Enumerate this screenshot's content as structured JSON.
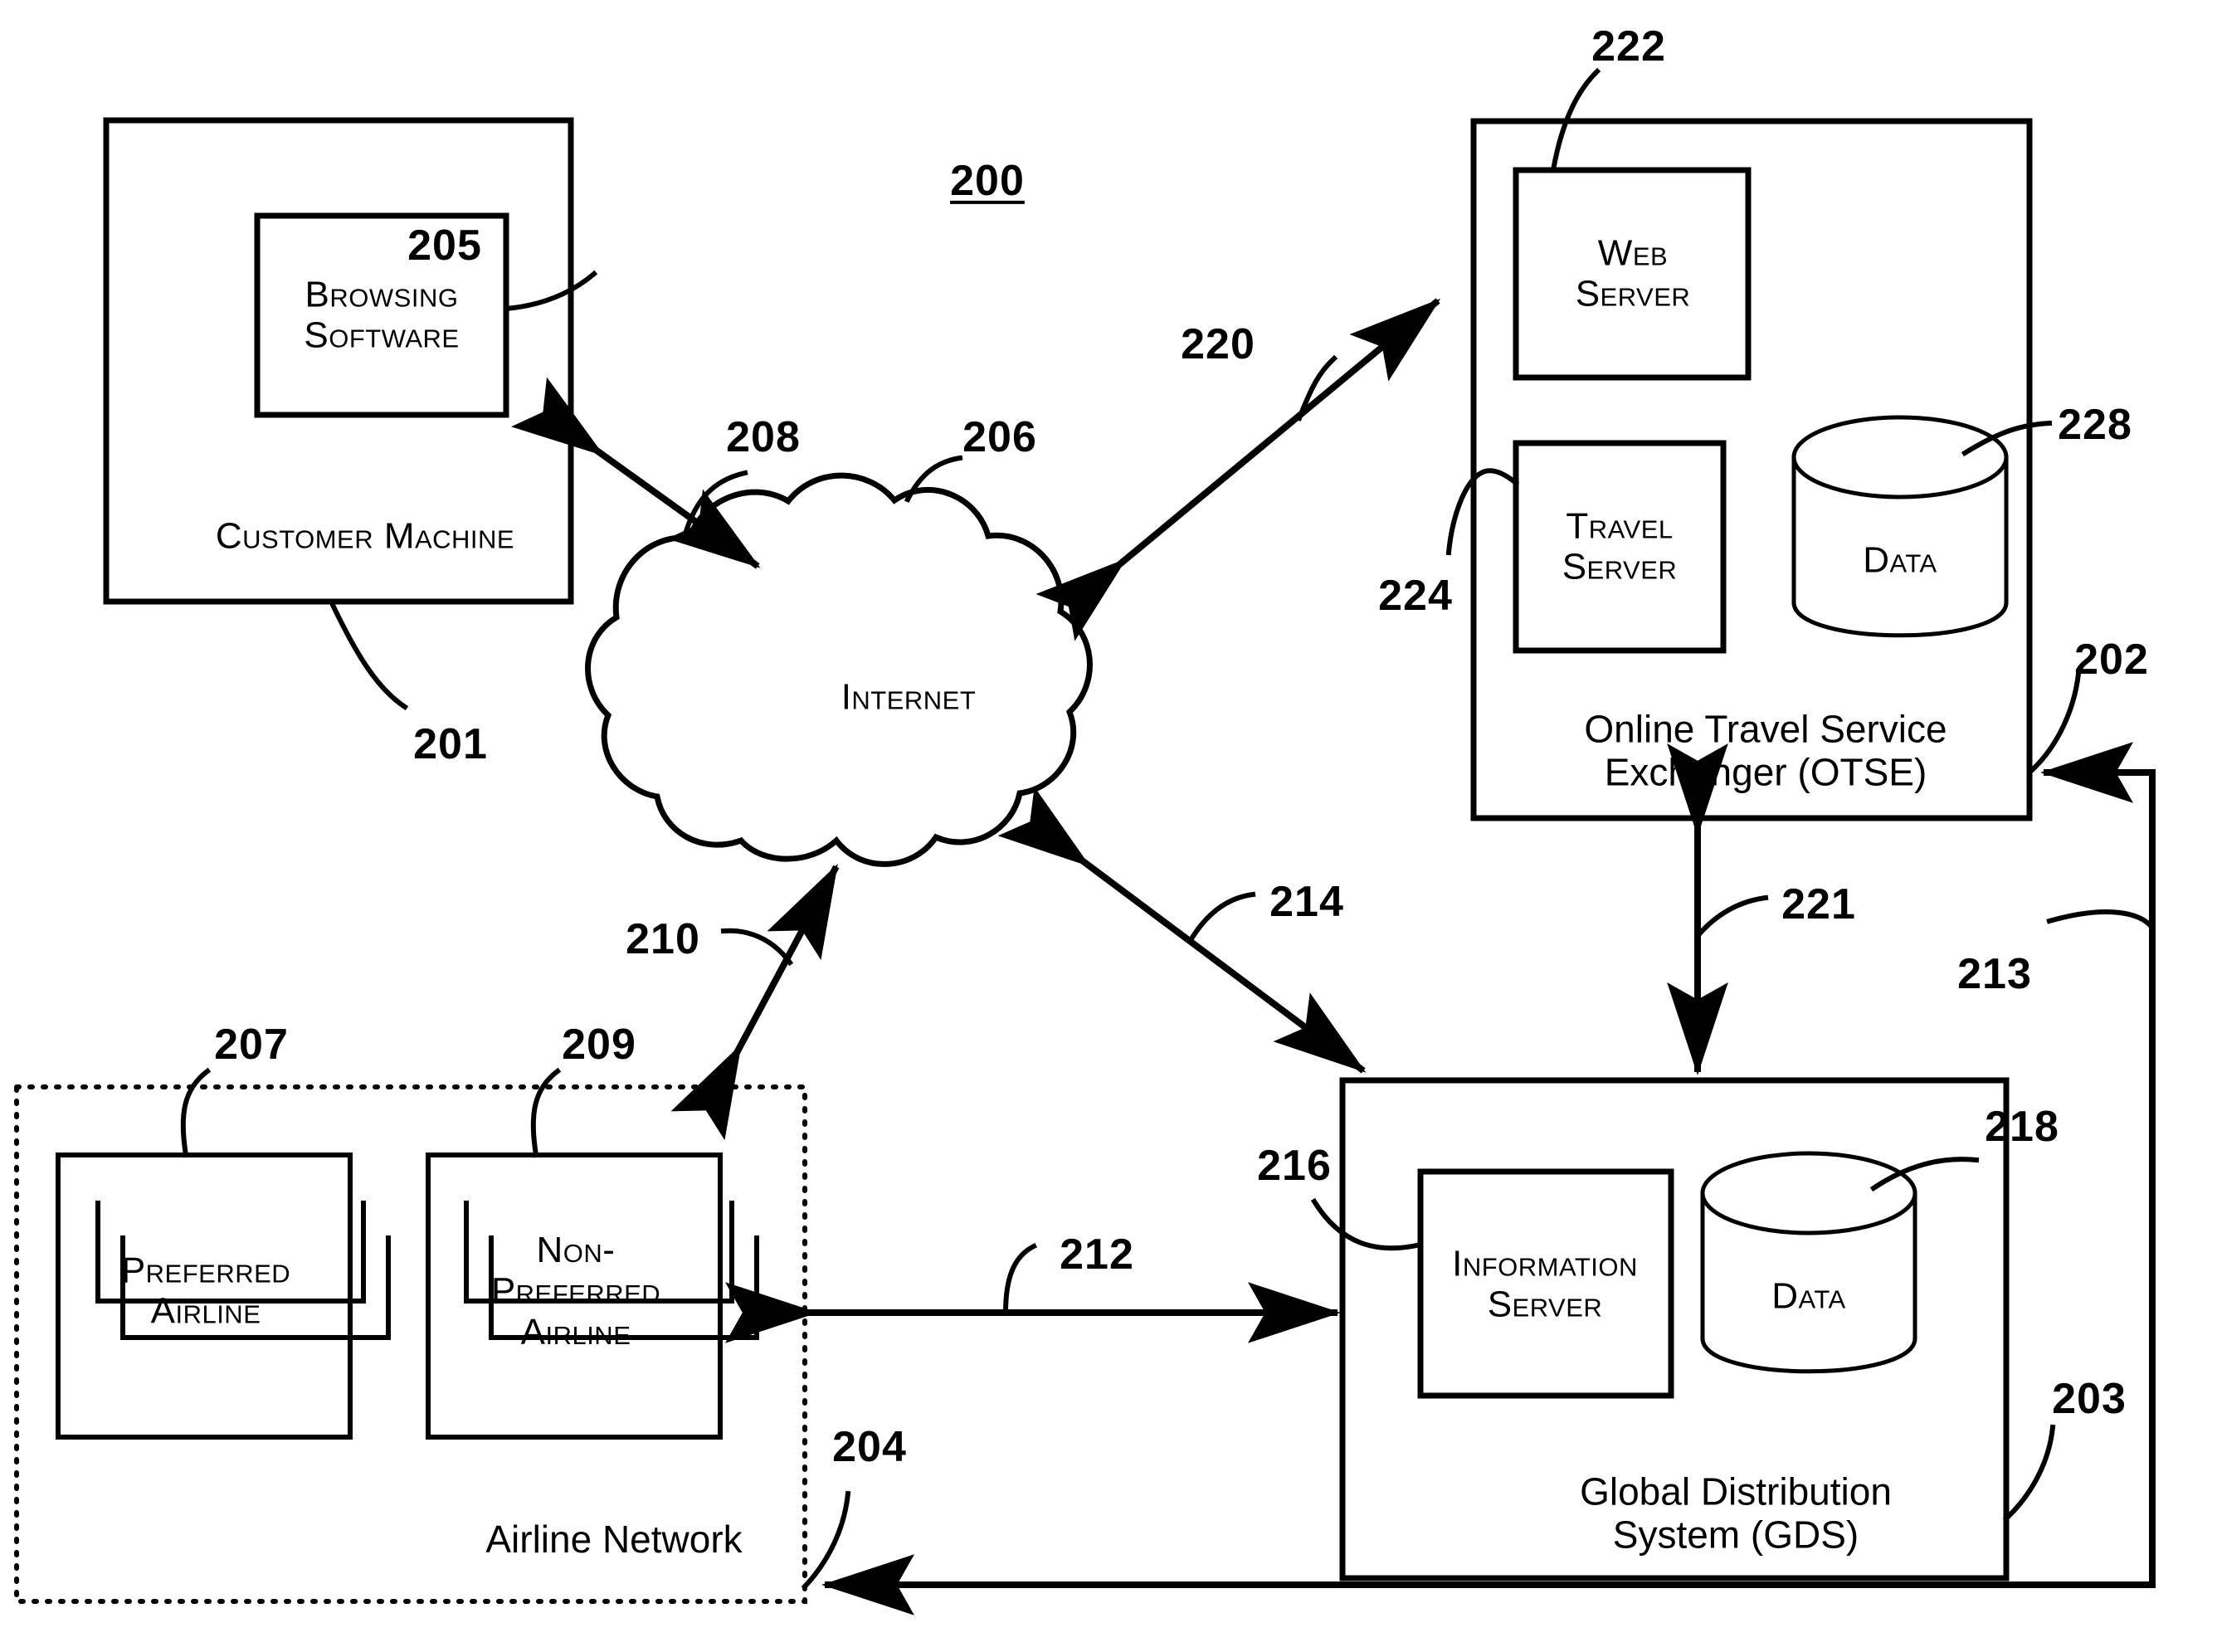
{
  "figure": {
    "number": "200",
    "title_caption": "",
    "blocks": {
      "customer_machine": {
        "label": "Customer Machine",
        "ref": "201",
        "inner": {
          "label": "Browsing\nSoftware",
          "ref": "205"
        }
      },
      "internet_cloud": {
        "label": "Internet",
        "ref": "206"
      },
      "otse": {
        "label": "Online Travel Service\nExchanger (OTSE)",
        "ref": "202",
        "web_server": {
          "label": "Web\nServer",
          "ref": "222"
        },
        "travel_server": {
          "label": "Travel\nServer",
          "ref": "224"
        },
        "data_store": {
          "label": "Data",
          "ref": "228"
        }
      },
      "airline_network": {
        "label": "Airline Network",
        "ref": "204",
        "preferred_airline": {
          "label": "Preferred\nAirline",
          "ref": "207"
        },
        "non_preferred_airline": {
          "label": "Non-\nPreferred\nAirline",
          "ref": "209"
        }
      },
      "gds": {
        "label": "Global Distribution\nSystem (GDS)",
        "ref": "203",
        "information_server": {
          "label": "Information\nServer",
          "ref": "216"
        },
        "data_store": {
          "label": "Data",
          "ref": "218"
        }
      }
    },
    "connections": [
      {
        "ref": "208",
        "from": "customer_machine",
        "to": "internet_cloud",
        "arrow": "both"
      },
      {
        "ref": "220",
        "from": "internet_cloud",
        "to": "otse",
        "arrow": "both"
      },
      {
        "ref": "210",
        "from": "airline_network",
        "to": "internet_cloud",
        "arrow": "both"
      },
      {
        "ref": "214",
        "from": "internet_cloud",
        "to": "gds",
        "arrow": "both"
      },
      {
        "ref": "212",
        "from": "airline_network",
        "to": "gds",
        "arrow": "both"
      },
      {
        "ref": "221",
        "from": "otse",
        "to": "gds",
        "arrow": "both"
      },
      {
        "ref": "213",
        "from": "airline_network",
        "to": "otse",
        "arrow": "single"
      }
    ],
    "colors": {
      "line": "#000000",
      "background": "#ffffff"
    }
  }
}
